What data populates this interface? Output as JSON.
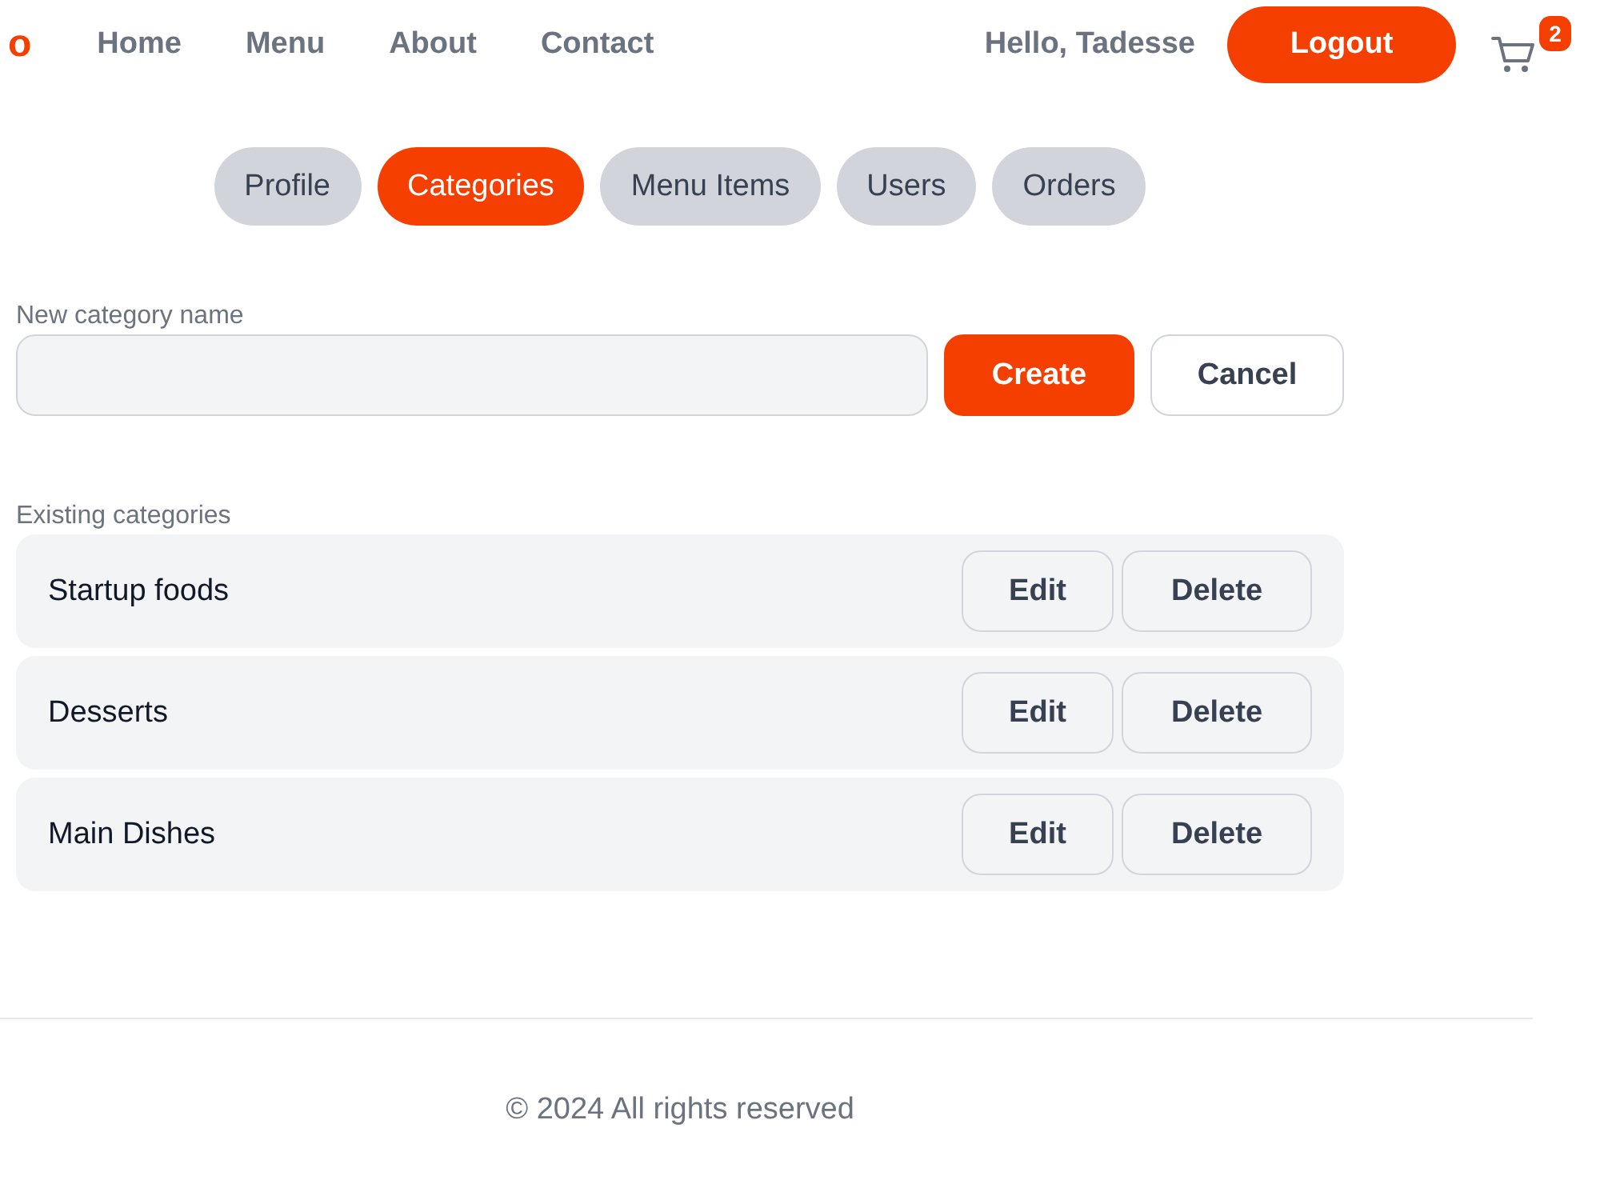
{
  "header": {
    "logo": "o",
    "nav": [
      "Home",
      "Menu",
      "About",
      "Contact"
    ],
    "greeting": "Hello, Tadesse",
    "logout": "Logout",
    "cart_badge": "2"
  },
  "tabs": [
    {
      "label": "Profile",
      "selected": false
    },
    {
      "label": "Categories",
      "selected": true
    },
    {
      "label": "Menu Items",
      "selected": false
    },
    {
      "label": "Users",
      "selected": false
    },
    {
      "label": "Orders",
      "selected": false
    }
  ],
  "form": {
    "label": "New category name",
    "buttons": [
      {
        "label": "Create",
        "kind": "primary"
      },
      {
        "label": "Cancel",
        "kind": "secondary"
      }
    ]
  },
  "categories": {
    "heading": "Existing categories",
    "items": [
      {
        "name": "Startup foods",
        "actions": [
          "Edit",
          "Delete"
        ]
      },
      {
        "name": "Desserts",
        "actions": [
          "Edit",
          "Delete"
        ]
      },
      {
        "name": "Main Dishes",
        "actions": [
          "Edit",
          "Delete"
        ]
      }
    ]
  },
  "footer": {
    "text": "© 2024 All rights reserved"
  }
}
